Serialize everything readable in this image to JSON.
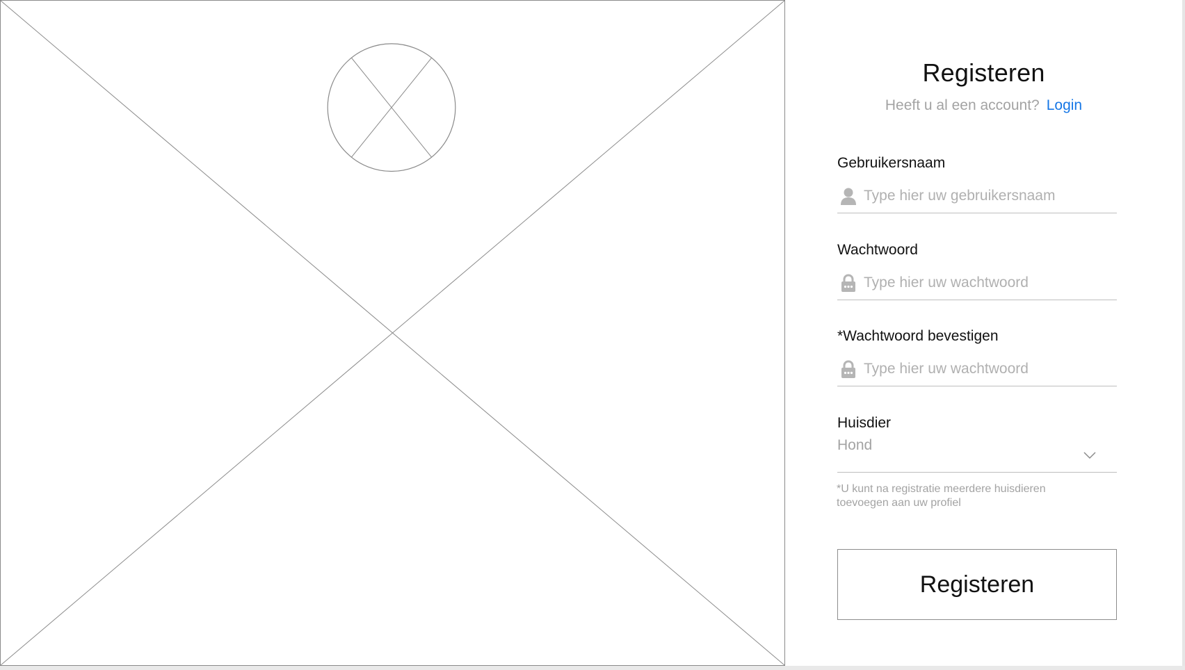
{
  "form": {
    "title": "Registeren",
    "login_prompt": "Heeft u al een account?",
    "login_link": "Login",
    "username": {
      "label": "Gebruikersnaam",
      "placeholder": "Type hier uw gebruikersnaam",
      "icon": "user-icon"
    },
    "password": {
      "label": "Wachtwoord",
      "placeholder": "Type hier uw wachtwoord",
      "icon": "lock-icon"
    },
    "confirm_password": {
      "label": "*Wachtwoord bevestigen",
      "placeholder": "Type hier uw wachtwoord",
      "icon": "lock-icon"
    },
    "pet": {
      "label": "Huisdier",
      "selected": "Hond",
      "icon": "chevron-down-icon"
    },
    "note": "*U kunt na registratie meerdere huisdieren toevoegen aan uw profiel",
    "submit_label": "Registeren"
  },
  "colors": {
    "link": "#1677e6",
    "placeholder": "#b0b0b0",
    "muted_text": "#a3a3a3",
    "border": "#8c8c8c"
  }
}
